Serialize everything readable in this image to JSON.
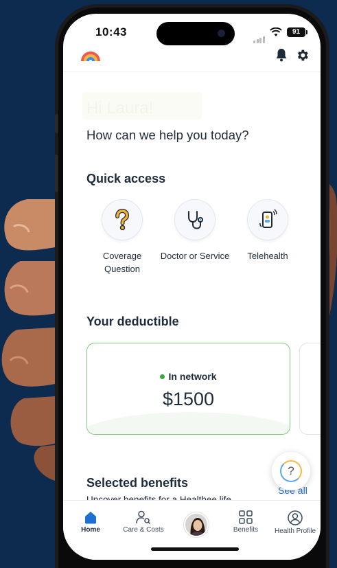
{
  "status_bar": {
    "time": "10:43",
    "battery": "91"
  },
  "greeting": "Hi Laura!",
  "prompt": "How can we help you today?",
  "quick_access": {
    "title": "Quick access",
    "items": [
      {
        "label": "Coverage Question",
        "icon": "question-icon"
      },
      {
        "label": "Doctor or Service",
        "icon": "stethoscope-icon"
      },
      {
        "label": "Telehealth",
        "icon": "phone-call-icon"
      }
    ]
  },
  "deductible": {
    "title": "Your deductible",
    "network_label": "In network",
    "amount": "$1500"
  },
  "benefits": {
    "title": "Selected benefits",
    "subtitle": "Uncover benefits for a Healthee life",
    "see_all": "See all"
  },
  "help_button": "?",
  "tabs": [
    {
      "label": "Home",
      "icon": "home-icon",
      "active": true
    },
    {
      "label": "Care & Costs",
      "icon": "person-search-icon",
      "active": false
    },
    {
      "label": "",
      "icon": "avatar",
      "active": false
    },
    {
      "label": "Benefits",
      "icon": "grid-icon",
      "active": false
    },
    {
      "label": "Health Profile",
      "icon": "profile-icon",
      "active": false
    }
  ],
  "colors": {
    "background": "#0c2b4f",
    "accent": "#1d6fd1",
    "card_border": "#7cc97a",
    "network_dot": "#3aa83a"
  }
}
